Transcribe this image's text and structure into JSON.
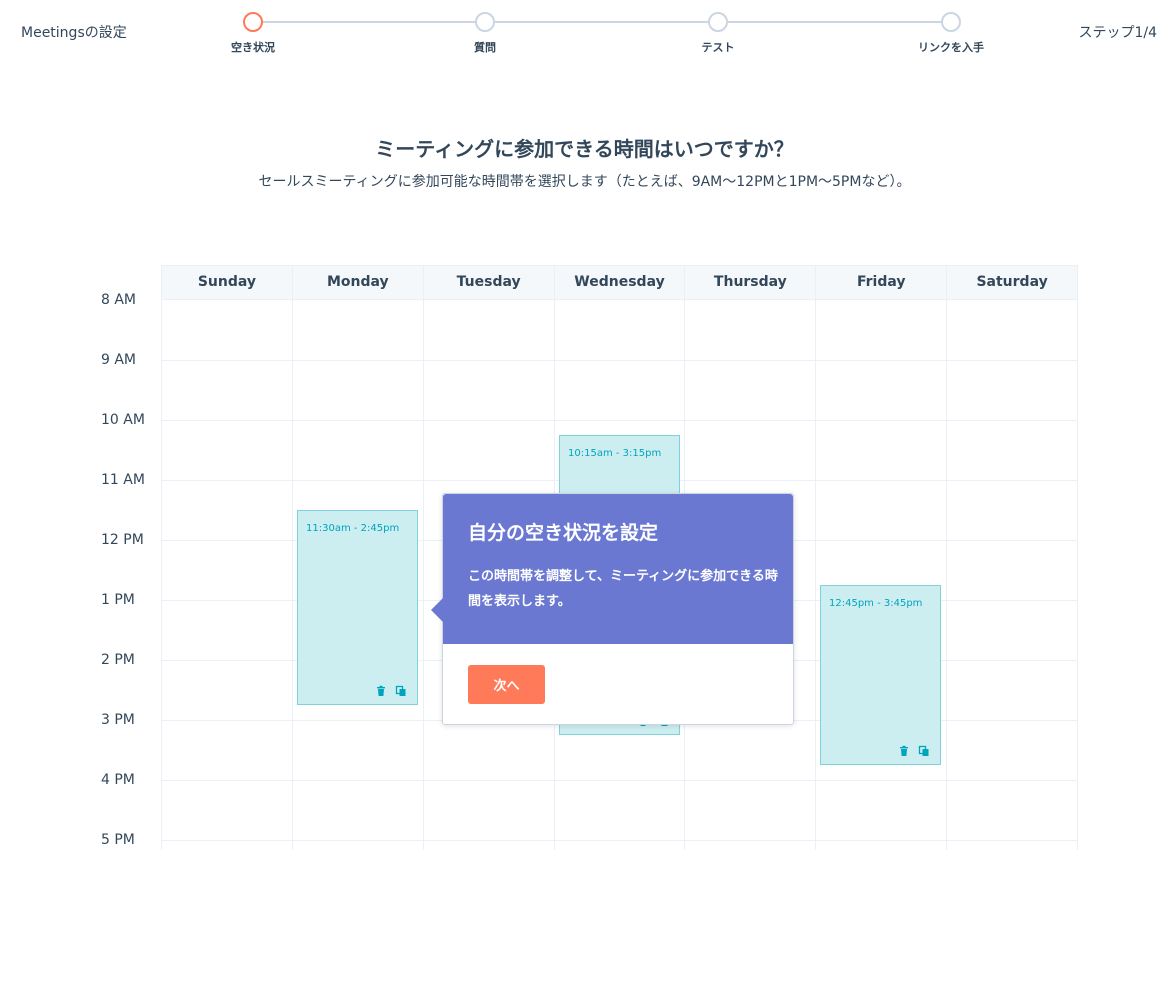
{
  "header": {
    "app_title": "Meetingsの設定",
    "step_count": "ステップ1/4",
    "steps": [
      {
        "label": "空き状況",
        "active": true
      },
      {
        "label": "質問",
        "active": false
      },
      {
        "label": "テスト",
        "active": false
      },
      {
        "label": "リンクを入手",
        "active": false
      }
    ]
  },
  "main": {
    "heading": "ミーティングに参加できる時間はいつですか？",
    "subheading": "セールスミーティングに参加可能な時間帯を選択します（たとえば、9AM〜12PMと1PM〜5PMなど）。"
  },
  "calendar": {
    "days": [
      "Sunday",
      "Monday",
      "Tuesday",
      "Wednesday",
      "Thursday",
      "Friday",
      "Saturday"
    ],
    "hours": [
      "8 AM",
      "9 AM",
      "10 AM",
      "11 AM",
      "12 PM",
      "1 PM",
      "2 PM",
      "3 PM",
      "4 PM",
      "5 PM"
    ],
    "blocks": [
      {
        "day": "Monday",
        "label": "11:30am - 2:45pm",
        "start": 11.5,
        "end": 14.75
      },
      {
        "day": "Wednesday",
        "label": "10:15am - 3:15pm",
        "start": 10.25,
        "end": 15.25
      },
      {
        "day": "Friday",
        "label": "12:45pm - 3:45pm",
        "start": 12.75,
        "end": 15.75
      }
    ],
    "icons": [
      "trash-icon",
      "copy-icon"
    ]
  },
  "popover": {
    "title": "自分の空き状況を設定",
    "body": "この時間帯を調整して、ミーティングに参加できる時間を表示します。",
    "next_label": "次へ"
  },
  "colors": {
    "accent": "#ff7a59",
    "popover": "#6a78d1",
    "block_fill": "#cdeef1",
    "block_border": "#7fd1de",
    "block_text": "#00a4bd"
  }
}
